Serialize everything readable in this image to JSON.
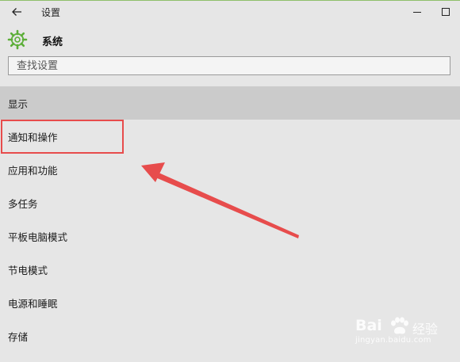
{
  "window": {
    "title": "设置",
    "back_icon": "arrow-left-icon",
    "minimize_icon": "minimize-icon",
    "maximize_icon": "maximize-icon"
  },
  "header": {
    "icon": "gear-icon",
    "icon_color": "#5cae38",
    "title": "系统"
  },
  "search": {
    "placeholder": "查找设置",
    "value": ""
  },
  "nav": {
    "items": [
      {
        "label": "显示",
        "selected": true
      },
      {
        "label": "通知和操作",
        "selected": false
      },
      {
        "label": "应用和功能",
        "selected": false
      },
      {
        "label": "多任务",
        "selected": false
      },
      {
        "label": "平板电脑模式",
        "selected": false
      },
      {
        "label": "节电模式",
        "selected": false
      },
      {
        "label": "电源和睡眠",
        "selected": false
      },
      {
        "label": "存储",
        "selected": false
      }
    ],
    "selected_bg": "#cbcbcb"
  },
  "annotation": {
    "highlighted_item": "通知和操作",
    "color": "#e74c4c"
  },
  "watermark": {
    "brand": "Bai",
    "paw_icon": "paw-icon",
    "text": "经验",
    "url": "jingyan.baidu.com"
  }
}
